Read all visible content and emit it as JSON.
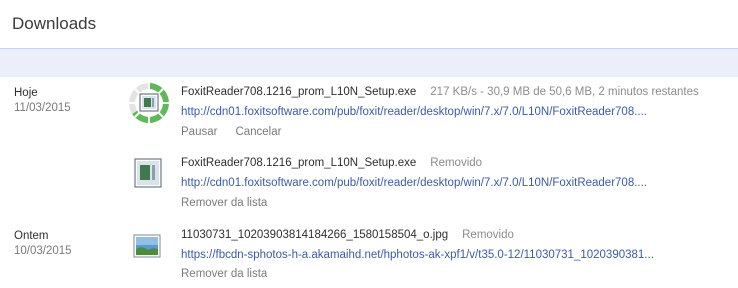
{
  "header": {
    "title": "Downloads"
  },
  "groups": [
    {
      "name": "Hoje",
      "date": "11/03/2015"
    },
    {
      "name": "Ontem",
      "date": "10/03/2015"
    }
  ],
  "items": [
    {
      "filename": "FoxitReader708.1216_prom_L10N_Setup.exe",
      "status": "217 KB/s - 30,9 MB de 50,6 MB, 2 minutos restantes",
      "url": "http://cdn01.foxitsoftware.com/pub/foxit/reader/desktop/win/7.x/7.0/L10N/FoxitReader708....",
      "pause": "Pausar",
      "cancel": "Cancelar",
      "icon": "installer-file-icon",
      "progress": 0.61
    },
    {
      "filename": "FoxitReader708.1216_prom_L10N_Setup.exe",
      "status": "Removido",
      "url": "http://cdn01.foxitsoftware.com/pub/foxit/reader/desktop/win/7.x/7.0/L10N/FoxitReader708....",
      "remove": "Remover da lista",
      "icon": "installer-file-icon"
    },
    {
      "filename": "11030731_10203903814184266_1580158504_o.jpg",
      "status": "Removido",
      "url": "https://fbcdn-sphotos-h-a.akamaihd.net/hphotos-ak-xpf1/v/t35.0-12/11030731_1020390381...",
      "remove": "Remover da lista",
      "icon": "image-file-icon"
    }
  ]
}
